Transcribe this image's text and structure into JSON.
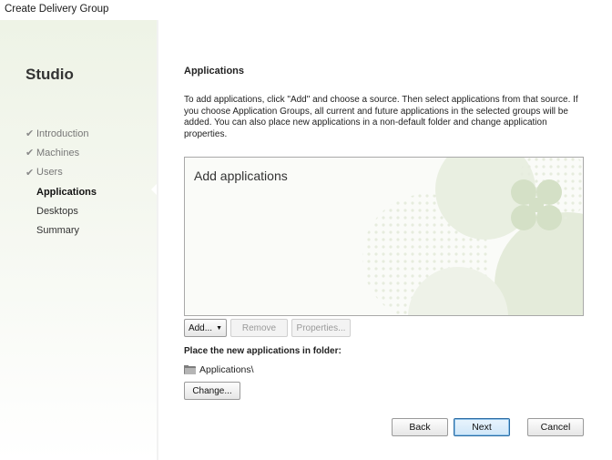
{
  "window": {
    "title": "Create Delivery Group"
  },
  "sidebar": {
    "product": "Studio",
    "steps": [
      {
        "label": "Introduction",
        "done": true
      },
      {
        "label": "Machines",
        "done": true
      },
      {
        "label": "Users",
        "done": true
      },
      {
        "label": "Applications",
        "current": true
      },
      {
        "label": "Desktops"
      },
      {
        "label": "Summary"
      }
    ],
    "check_glyph": "✔"
  },
  "main": {
    "section_title": "Applications",
    "description": "To add applications, click \"Add\" and choose a source. Then select applications from that source. If you choose Application Groups, all current and future applications in the selected groups will be added. You can also place new applications in a non-default folder and change application properties.",
    "app_list": {
      "placeholder": "Add applications",
      "items": []
    },
    "buttons": {
      "add": "Add...",
      "remove": "Remove",
      "properties": "Properties...",
      "change": "Change..."
    },
    "folder_label": "Place the new applications in folder:",
    "folder_path": "Applications\\"
  },
  "footer": {
    "back": "Back",
    "next": "Next",
    "cancel": "Cancel"
  },
  "colors": {
    "accent": "#2b6ca3",
    "sidebar_bg": "#eef3e6",
    "decor": "#dfe8d4"
  },
  "icons": {
    "step_done": "check-icon",
    "folder": "folder-icon",
    "dropdown": "caret-down-icon"
  }
}
